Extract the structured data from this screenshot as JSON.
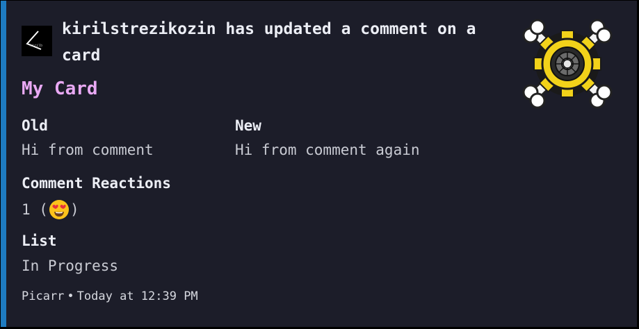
{
  "author": {
    "name": "kirilstrezikozin has updated a comment on a card",
    "avatar_icon": "avatar-logo-icon"
  },
  "thumbnail_icon": "gear-skull-crossbones-icon",
  "title": "My Card",
  "fields": {
    "old_name": "Old",
    "old_value": "Hi from comment",
    "new_name": "New",
    "new_value": "Hi from comment again",
    "reactions_name": "Comment Reactions",
    "reactions_count": "1 (",
    "reactions_close": ")",
    "reaction_emoji": "heart-eyes-emoji-icon",
    "list_name": "List",
    "list_value": "In Progress"
  },
  "footer": {
    "app": "Picarr",
    "separator": "•",
    "timestamp": "Today at 12:39 PM"
  },
  "colors": {
    "background": "#1c1d29",
    "accent_bar": "#1e7bc0",
    "title": "#e9a9f4"
  }
}
